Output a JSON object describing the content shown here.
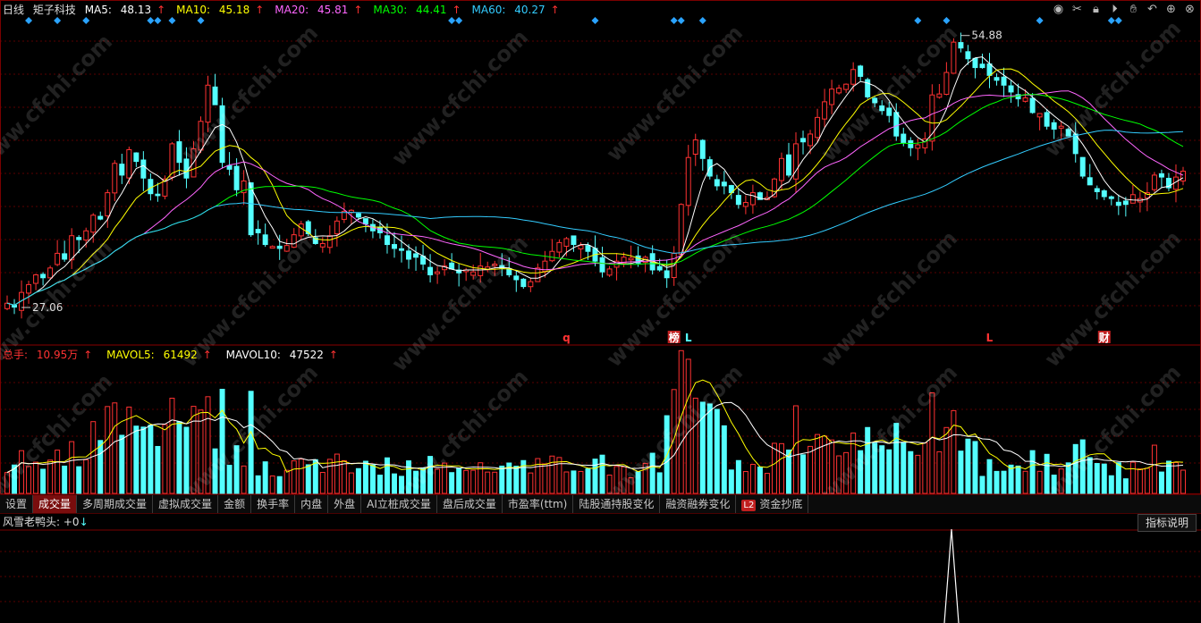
{
  "header": {
    "period": "日线",
    "stock_name": "矩子科技",
    "ma": [
      {
        "label": "MA5:",
        "value": "48.13",
        "arrow": "↑",
        "color": "#ffffff"
      },
      {
        "label": "MA10:",
        "value": "45.18",
        "arrow": "↑",
        "color": "#ffff00"
      },
      {
        "label": "MA20:",
        "value": "45.81",
        "arrow": "↑",
        "color": "#ff66ff"
      },
      {
        "label": "MA30:",
        "value": "44.41",
        "arrow": "↑",
        "color": "#00ff00"
      },
      {
        "label": "MA60:",
        "value": "40.27",
        "arrow": "↑",
        "color": "#33ccff"
      }
    ]
  },
  "toolbar": {
    "icons": [
      "eye-icon",
      "scissors-icon",
      "lock-icon",
      "play-icon",
      "hand-icon",
      "undo-icon",
      "plus-icon",
      "close-icon"
    ]
  },
  "colors": {
    "up": "#ff3232",
    "down": "#54ffff",
    "grid": "#5a0000",
    "diamond": "#2aa3ff"
  },
  "price_chart": {
    "high_label": "54.88",
    "low_label": "27.06",
    "markers": [
      {
        "text": "q",
        "color": "#ff3232"
      },
      {
        "text": "榜",
        "color": "#ffffff",
        "bg": "#c02020"
      },
      {
        "text": "L",
        "color": "#54ffff"
      },
      {
        "text": "L",
        "color": "#ff3232"
      },
      {
        "text": "财",
        "color": "#ffffff",
        "bg": "#c02020"
      }
    ]
  },
  "volume": {
    "total_label": "总手:",
    "total_value": "10.95万",
    "mavol5_label": "MAVOL5:",
    "mavol5_value": "61492",
    "mavol10_label": "MAVOL10:",
    "mavol10_value": "47522",
    "arrow": "↑"
  },
  "tabs": [
    "设置",
    "成交量",
    "多周期成交量",
    "虚拟成交量",
    "金额",
    "换手率",
    "内盘",
    "外盘",
    "AI立桩成交量",
    "盘后成交量",
    "市盈率(ttm)",
    "陆股通持股变化",
    "融资融券变化",
    "资金抄底"
  ],
  "tab_active": "成交量",
  "l2_badge": "L2",
  "indicator": {
    "name": "风雪老鸭头:",
    "value": "+0",
    "arrow": "↓"
  },
  "help_button": "指标说明",
  "watermark": "www.cfchi.com",
  "chart_data": {
    "type": "candlestick",
    "close": [
      27.5,
      27.1,
      28.6,
      29.4,
      30.4,
      30.1,
      31.1,
      32.6,
      32.0,
      34.4,
      34.0,
      34.9,
      36.5,
      36.1,
      38.8,
      41.8,
      40.6,
      43.2,
      42.0,
      40.3,
      38.7,
      38.5,
      40.2,
      43.8,
      41.9,
      40.3,
      43.3,
      46.1,
      49.8,
      47.8,
      41.9,
      41.2,
      39.1,
      40.0,
      34.5,
      34.7,
      33.5,
      33.3,
      33.1,
      33.4,
      34.5,
      35.6,
      34.6,
      33.6,
      33.6,
      34.4,
      35.9,
      36.9,
      37.0,
      36.3,
      35.6,
      34.9,
      34.7,
      33.5,
      33.1,
      32.9,
      32.0,
      32.2,
      31.5,
      30.4,
      30.7,
      31.3,
      31.0,
      30.6,
      30.9,
      30.7,
      31.3,
      31.2,
      31.5,
      31.1,
      30.4,
      29.9,
      29.2,
      29.7,
      31.1,
      31.8,
      32.8,
      33.7,
      34.1,
      33.5,
      33.4,
      32.8,
      31.8,
      30.7,
      31.0,
      31.8,
      32.2,
      32.1,
      31.6,
      32.2,
      30.9,
      30.9,
      30.1,
      32.6,
      37.6,
      42.4,
      44.2,
      42.3,
      40.5,
      39.5,
      39.5,
      38.8,
      37.6,
      37.8,
      38.8,
      38.1,
      38.3,
      40.2,
      42.3,
      40.6,
      43.8,
      44.0,
      44.8,
      46.5,
      48.1,
      49.4,
      49.5,
      49.9,
      51.4,
      50.7,
      48.6,
      48.0,
      47.2,
      46.7,
      44.6,
      43.9,
      43.4,
      43.7,
      44.3,
      48.8,
      48.9,
      51.1,
      54.2,
      53.6,
      52.5,
      51.6,
      51.6,
      50.8,
      50.3,
      49.8,
      49.1,
      48.4,
      48.5,
      47.0,
      46.9,
      45.6,
      45.3,
      45.6,
      44.6,
      42.8,
      40.5,
      39.6,
      38.9,
      38.4,
      38.2,
      37.5,
      37.6,
      38.6,
      38.2,
      38.8,
      40.6,
      40.4,
      39.3,
      40.4,
      41.0
    ],
    "ma5_last": 48.13,
    "ma10_last": 45.18,
    "ma20_last": 45.81,
    "ma30_last": 44.41,
    "ma60_last": 40.27,
    "volume_latest": 109500,
    "mavol5": 61492,
    "mavol10": 47522,
    "price_high": 54.88,
    "price_low": 27.06
  }
}
